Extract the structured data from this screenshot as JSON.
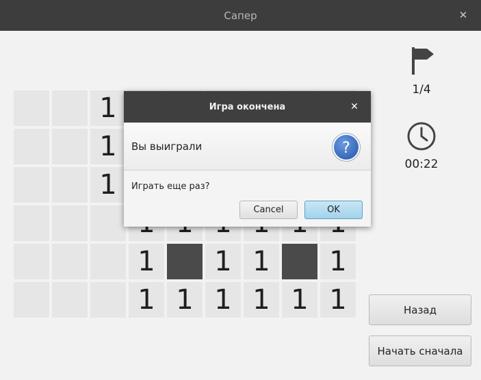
{
  "window": {
    "title": "Сапер"
  },
  "board": {
    "rows": [
      [
        "",
        "",
        "1",
        "",
        "",
        "",
        "",
        "",
        ""
      ],
      [
        "",
        "",
        "1",
        "",
        "",
        "",
        "",
        "",
        ""
      ],
      [
        "",
        "",
        "1",
        "",
        "",
        "",
        "",
        "",
        ""
      ],
      [
        "",
        "",
        "",
        "1",
        "1",
        "1",
        "1",
        "1",
        "1"
      ],
      [
        "",
        "",
        "",
        "1",
        "*",
        "1",
        "1",
        "*",
        "1"
      ],
      [
        "",
        "",
        "",
        "1",
        "1",
        "1",
        "1",
        "1",
        "1"
      ]
    ]
  },
  "status": {
    "flags": "1/4",
    "time": "00:22"
  },
  "buttons": {
    "back": "Назад",
    "restart": "Начать сначала"
  },
  "dialog": {
    "title": "Игра окончена",
    "header": "Вы выиграли",
    "content": "Играть еще раз?",
    "cancel": "Cancel",
    "ok": "OK"
  },
  "icons": {
    "flag": "flag-icon",
    "clock": "clock-icon",
    "question": "question-icon",
    "close": "close-icon"
  },
  "colors": {
    "titlebar": "#3d3d3d",
    "cell": "#e6e6e6",
    "mine": "#4a4a4a",
    "ok_button": "#a2d2ea",
    "question_icon": "#3a6fc4"
  }
}
